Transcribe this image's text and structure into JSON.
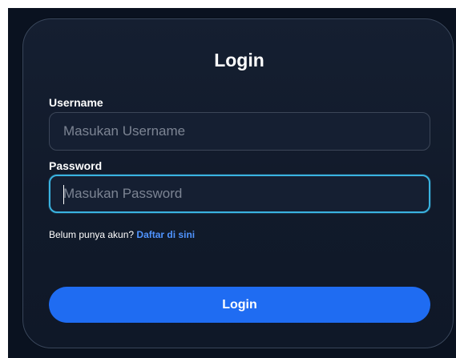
{
  "login": {
    "title": "Login",
    "username_label": "Username",
    "username_placeholder": "Masukan Username",
    "password_label": "Password",
    "password_placeholder": "Masukan Password",
    "register_prompt": "Belum punya akun?",
    "register_link": "Daftar di sini",
    "submit_label": "Login"
  }
}
